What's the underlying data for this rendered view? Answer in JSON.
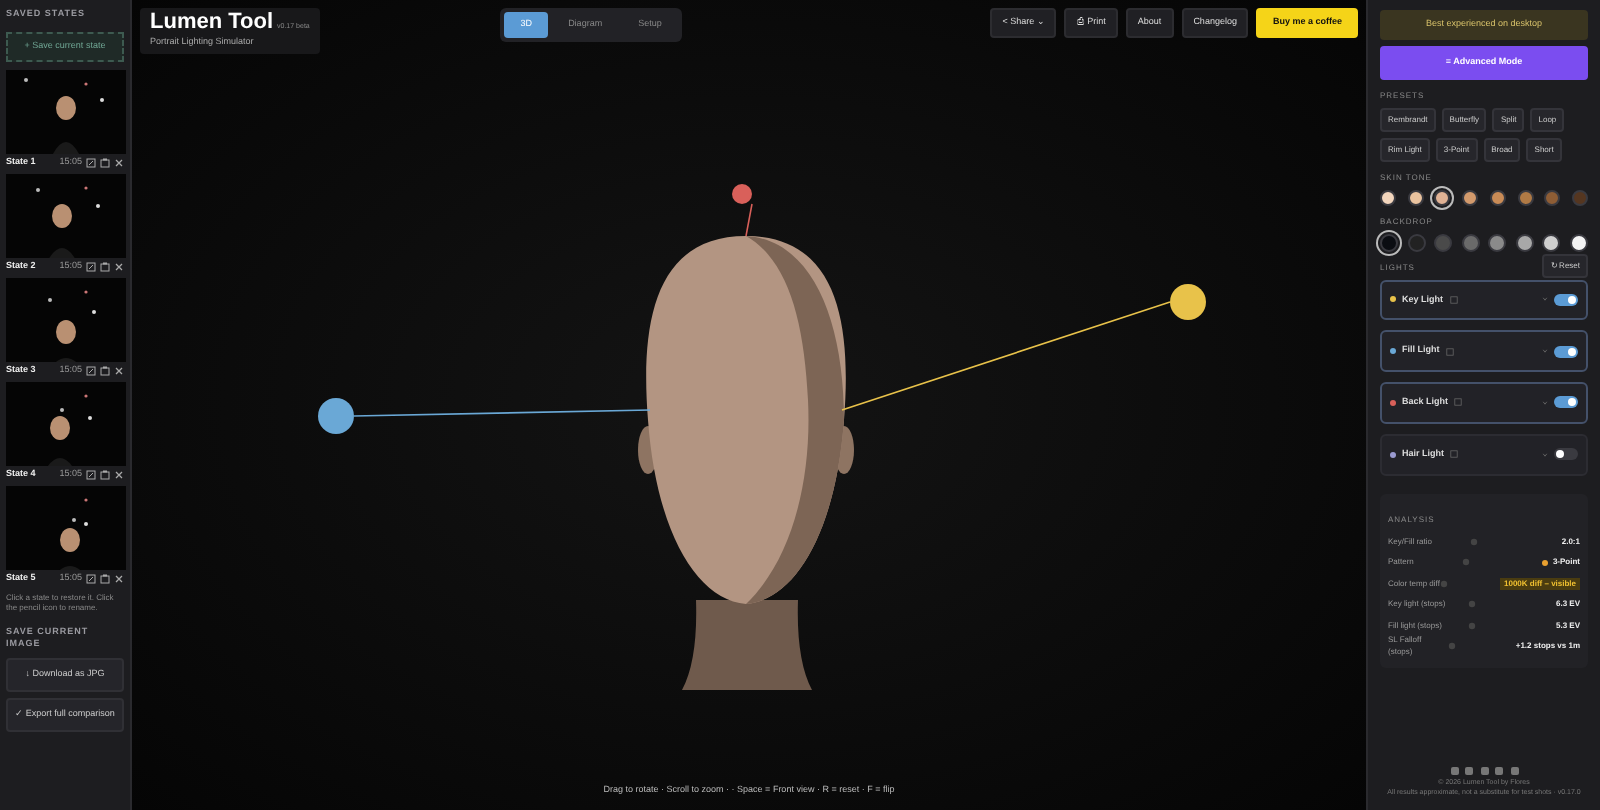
{
  "sidebar": {
    "title": "SAVED STATES",
    "save_button": "+ Save current state",
    "states": [
      {
        "name": "State 1",
        "time": "15:05"
      },
      {
        "name": "State 2",
        "time": "15:05"
      },
      {
        "name": "State 3",
        "time": "15:05"
      },
      {
        "name": "State 4",
        "time": "15:05"
      },
      {
        "name": "State 5",
        "time": "15:05"
      }
    ],
    "hint": "Click a state to restore it. Click the pencil icon to rename.",
    "export_title": "SAVE CURRENT IMAGE",
    "export_buttons": [
      "↓ Download as JPG",
      "✓ Export full comparison"
    ]
  },
  "header": {
    "title": "Lumen Tool",
    "version": "v0.17 beta",
    "subtitle": "Portrait Lighting Simulator",
    "view_tabs": [
      {
        "label": "3D",
        "selected": true
      },
      {
        "label": "Diagram",
        "selected": false
      },
      {
        "label": "Setup",
        "selected": false
      }
    ],
    "actions": [
      {
        "label": "< Share ⌄",
        "kind": "plain"
      },
      {
        "label": "⎙ Print",
        "kind": "plain"
      },
      {
        "label": "About",
        "kind": "plain"
      },
      {
        "label": "Changelog",
        "kind": "plain"
      },
      {
        "label": "Buy me a coffee",
        "kind": "primary"
      }
    ]
  },
  "canvas": {
    "hint": "Drag to rotate · Scroll to zoom · · Space = Front view · R = reset · F = flip"
  },
  "panel": {
    "notice": "Best experienced on desktop",
    "advanced_button": "≡ Advanced Mode",
    "presets_title": "PRESETS",
    "presets": [
      "Rembrandt",
      "Butterfly",
      "Split",
      "Loop",
      "Rim Light",
      "3-Point",
      "Broad",
      "Short"
    ],
    "skin_title": "SKIN TONE",
    "skin_tones": [
      {
        "color": "#f3d6bd",
        "selected": false
      },
      {
        "color": "#eac39f",
        "selected": false
      },
      {
        "color": "#e0b295",
        "selected": true
      },
      {
        "color": "#d39a6c",
        "selected": false
      },
      {
        "color": "#c98b56",
        "selected": false
      },
      {
        "color": "#b07a45",
        "selected": false
      },
      {
        "color": "#8e5d35",
        "selected": false
      },
      {
        "color": "#553620",
        "selected": false
      }
    ],
    "backdrop_title": "BACKDROP",
    "backdrops": [
      {
        "color": "#0b0d12",
        "selected": true
      },
      {
        "color": "#222222",
        "selected": false
      },
      {
        "color": "#4a4a4a",
        "selected": false
      },
      {
        "color": "#6a6a6a",
        "selected": false
      },
      {
        "color": "#8a8a8a",
        "selected": false
      },
      {
        "color": "#a8a8a8",
        "selected": false
      },
      {
        "color": "#cfcfcf",
        "selected": false
      },
      {
        "color": "#f4f4f4",
        "selected": false
      }
    ],
    "lights_title": "LIGHTS",
    "reset_button": "↻ Reset",
    "lights": [
      {
        "name": "Key Light",
        "color": "#e8c24a",
        "on": true,
        "selected": true
      },
      {
        "name": "Fill Light",
        "color": "#6aa8d6",
        "on": true,
        "selected": true
      },
      {
        "name": "Back Light",
        "color": "#d9605a",
        "on": true,
        "selected": true
      },
      {
        "name": "Hair Light",
        "color": "#9a9ad0",
        "on": false,
        "selected": false
      }
    ],
    "analysis_title": "ANALYSIS",
    "analysis": [
      {
        "label": "Key/Fill ratio",
        "value": "2.0:1",
        "kind": "plain"
      },
      {
        "label": "Pattern",
        "value": "3-Point",
        "kind": "dot"
      },
      {
        "label": "Color temp diff",
        "value": "1000K diff – visible",
        "kind": "warning"
      },
      {
        "label": "Key light (stops)",
        "value": "6.3 EV",
        "kind": "plain"
      },
      {
        "label": "Fill light (stops)",
        "value": "5.3 EV",
        "kind": "plain"
      },
      {
        "label": "SL Falloff (stops)",
        "value": "+1.2 stops vs 1m",
        "kind": "plain"
      }
    ],
    "footer": [
      "© 2026 Lumen Tool by Flores",
      "All results approximate, not a substitute for test shots · v0.17.0"
    ]
  }
}
